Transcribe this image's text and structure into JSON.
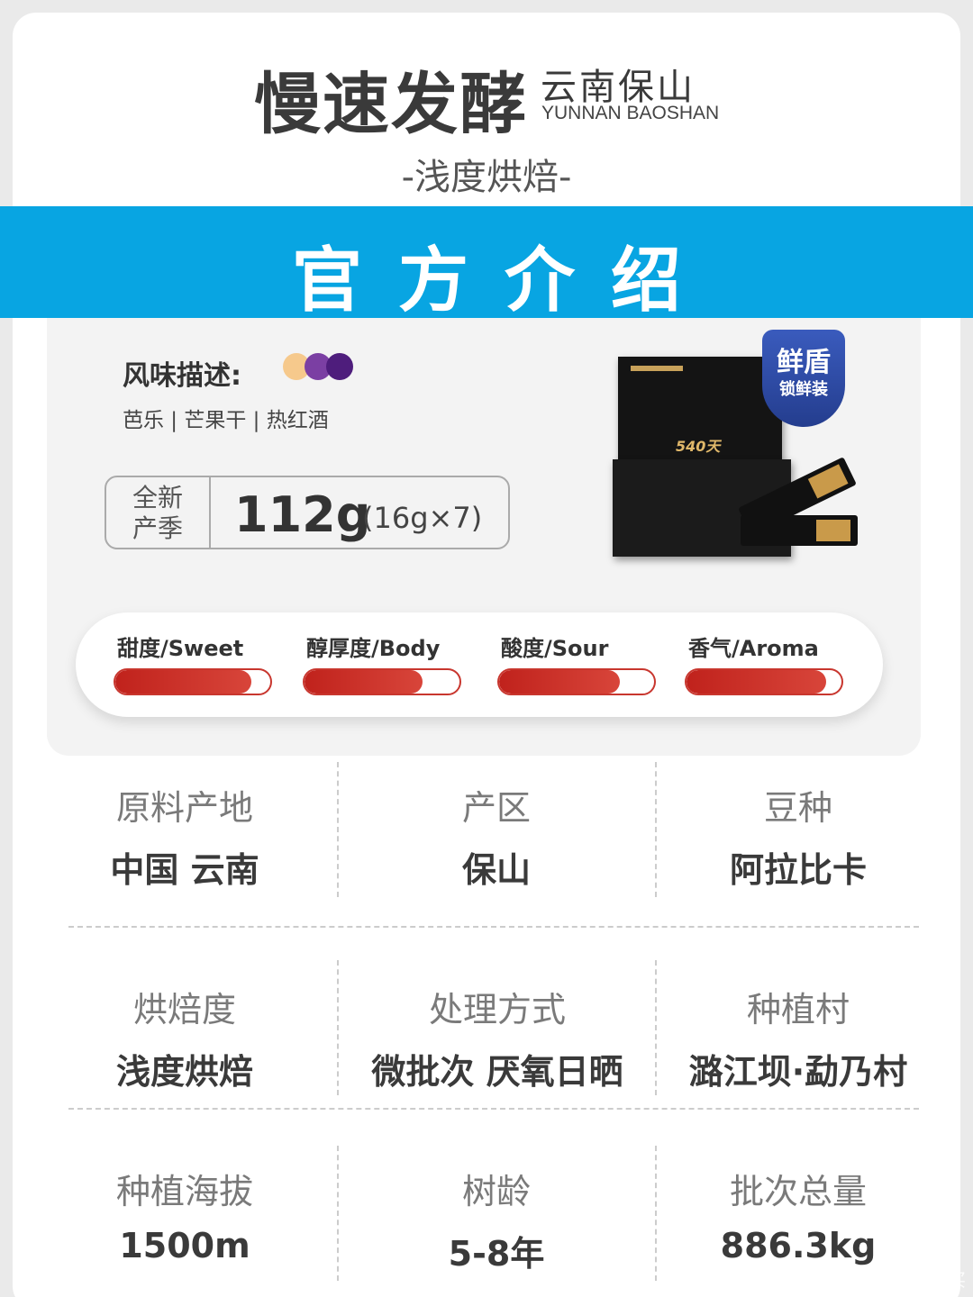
{
  "header": {
    "title": "慢速发酵",
    "region_cn": "云南保山",
    "region_en": "YUNNAN BAOSHAN",
    "roast_subtitle": "-浅度烘焙-"
  },
  "banner": {
    "text": "官方介绍"
  },
  "flavor": {
    "label": "风味描述:",
    "notes": "芭乐 | 芒果干 | 热红酒",
    "dot_colors": [
      "#f6c98c",
      "#7b3fa3",
      "#4e1d7c"
    ]
  },
  "weight": {
    "tag_line1": "全新",
    "tag_line2": "产季",
    "value": "112g",
    "detail": "(16g×7)"
  },
  "product": {
    "box_label": "540天",
    "shield_main": "鲜盾",
    "shield_sub": "锁鲜装"
  },
  "meters": [
    {
      "label": "甜度/Sweet",
      "level": 0.88
    },
    {
      "label": "醇厚度/Body",
      "level": 0.76
    },
    {
      "label": "酸度/Sour",
      "level": 0.78
    },
    {
      "label": "香气/Aroma",
      "level": 0.9
    }
  ],
  "specs": [
    {
      "label": "原料产地",
      "value": "中国 云南"
    },
    {
      "label": "产区",
      "value": "保山"
    },
    {
      "label": "豆种",
      "value": "阿拉比卡"
    },
    {
      "label": "烘焙度",
      "value": "浅度烘焙"
    },
    {
      "label": "处理方式",
      "value": "微批次 厌氧日晒"
    },
    {
      "label": "种植村",
      "value": "潞江坝·勐乃村"
    },
    {
      "label": "种植海拔",
      "value": "1500m"
    },
    {
      "label": "树龄",
      "value": "5-8年"
    },
    {
      "label": "批次总量",
      "value": "886.3kg"
    }
  ],
  "watermark": "值 什么值得买",
  "colors": {
    "banner": "#08a5e2",
    "meter_fill": "#c0221c",
    "shield": "#2f4aa6"
  }
}
